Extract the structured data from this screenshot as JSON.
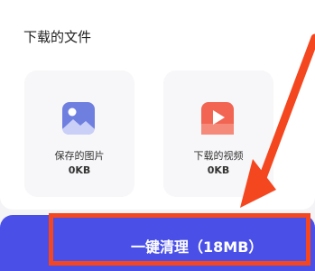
{
  "section": {
    "title": "下载的文件"
  },
  "cards": [
    {
      "label": "保存的图片",
      "size": "0KB",
      "icon": "image-icon"
    },
    {
      "label": "下载的视频",
      "size": "0KB",
      "icon": "video-play-icon"
    }
  ],
  "action": {
    "clean_label": "一键清理（18MB）"
  },
  "colors": {
    "primary": "#4a4fe8",
    "annotation": "#f4471f",
    "image_icon": "#6f7fe0",
    "video_icon": "#f26552"
  }
}
